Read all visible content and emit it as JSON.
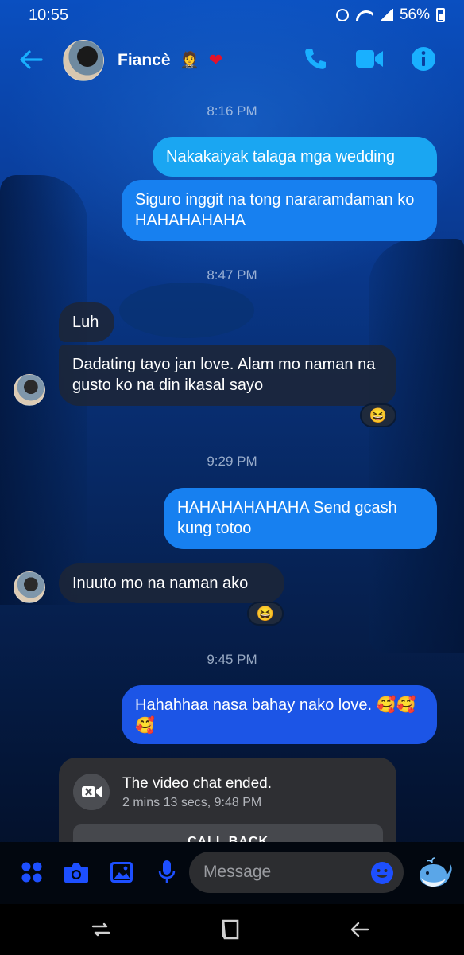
{
  "status_bar": {
    "time": "10:55",
    "battery": "56%"
  },
  "header": {
    "contact_name": "Fiancè",
    "contact_emoji": "🤵",
    "heart_emoji": "❤"
  },
  "messages": [
    {
      "type": "timestamp",
      "text": "8:16 PM"
    },
    {
      "type": "outgoing",
      "text": "Nakakaiyak talaga mga wedding"
    },
    {
      "type": "outgoing",
      "text": "Siguro inggit na tong nararamdaman ko HAHAHAHAHA"
    },
    {
      "type": "timestamp",
      "text": "8:47 PM"
    },
    {
      "type": "incoming",
      "text": "Luh"
    },
    {
      "type": "incoming",
      "text": "Dadating tayo jan love. Alam mo naman na gusto ko na din ikasal sayo",
      "reaction": "😆"
    },
    {
      "type": "timestamp",
      "text": "9:29 PM"
    },
    {
      "type": "outgoing",
      "text": "HAHAHAHAHAHA Send gcash kung totoo"
    },
    {
      "type": "incoming",
      "text": "Inuuto mo na naman ako",
      "reaction": "😆"
    },
    {
      "type": "timestamp",
      "text": "9:45 PM"
    },
    {
      "type": "outgoing",
      "text": "Hahahhaa nasa bahay nako love. 🥰🥰🥰"
    }
  ],
  "call_card": {
    "title": "The video chat ended.",
    "subtitle": "2 mins 13 secs, 9:48 PM",
    "button_label": "CALL BACK"
  },
  "composer": {
    "placeholder": "Message"
  },
  "icons": {
    "back": "arrow-left-icon",
    "call": "phone-icon",
    "video": "video-camera-icon",
    "info": "info-icon",
    "apps": "four-dots-icon",
    "camera": "camera-icon",
    "gallery": "image-icon",
    "mic": "microphone-icon",
    "emoji": "smiley-icon",
    "quick_reaction": "whale-icon"
  },
  "colors": {
    "accent": "#1aa6f2",
    "outgoing_deep": "#1c55e6",
    "incoming": "#1c2638",
    "bar_icon": "#1d4fff"
  }
}
